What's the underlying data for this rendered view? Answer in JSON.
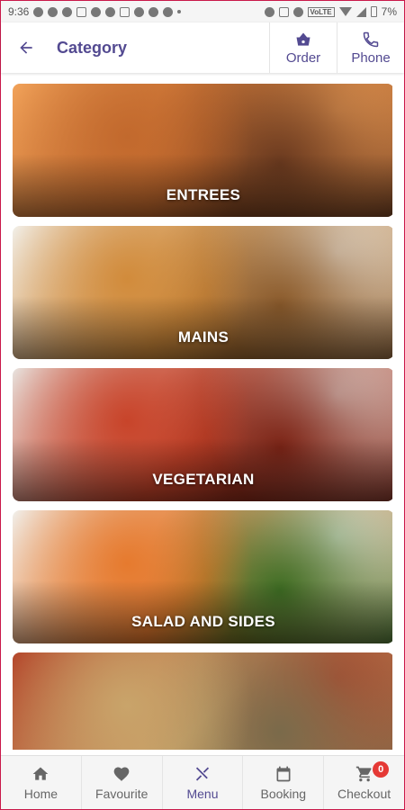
{
  "status_bar": {
    "time": "9:36",
    "network": "VoLTE",
    "battery": "7%"
  },
  "header": {
    "title": "Category",
    "order_label": "Order",
    "phone_label": "Phone"
  },
  "categories": [
    {
      "label": "ENTREES",
      "colors": [
        "#6b3a1f",
        "#c2692d",
        "#f2a35a"
      ]
    },
    {
      "label": "MAINS",
      "colors": [
        "#8a5a2b",
        "#d18b3b",
        "#f2f0ea"
      ]
    },
    {
      "label": "VEGETARIAN",
      "colors": [
        "#7b2416",
        "#c8442a",
        "#e8e4e0"
      ]
    },
    {
      "label": "SALAD AND SIDES",
      "colors": [
        "#3e6d23",
        "#e67a2e",
        "#f1f0ec"
      ]
    },
    {
      "label": "",
      "colors": [
        "#7a6a4a",
        "#c9a46a",
        "#b4462b"
      ]
    }
  ],
  "bottom_nav": {
    "items": [
      {
        "label": "Home",
        "icon": "home-icon"
      },
      {
        "label": "Favourite",
        "icon": "heart-icon"
      },
      {
        "label": "Menu",
        "icon": "utensils-icon"
      },
      {
        "label": "Booking",
        "icon": "calendar-icon"
      },
      {
        "label": "Checkout",
        "icon": "cart-icon"
      }
    ],
    "cart_count": "0"
  },
  "colors": {
    "accent": "#534a91",
    "badge": "#e53935"
  }
}
